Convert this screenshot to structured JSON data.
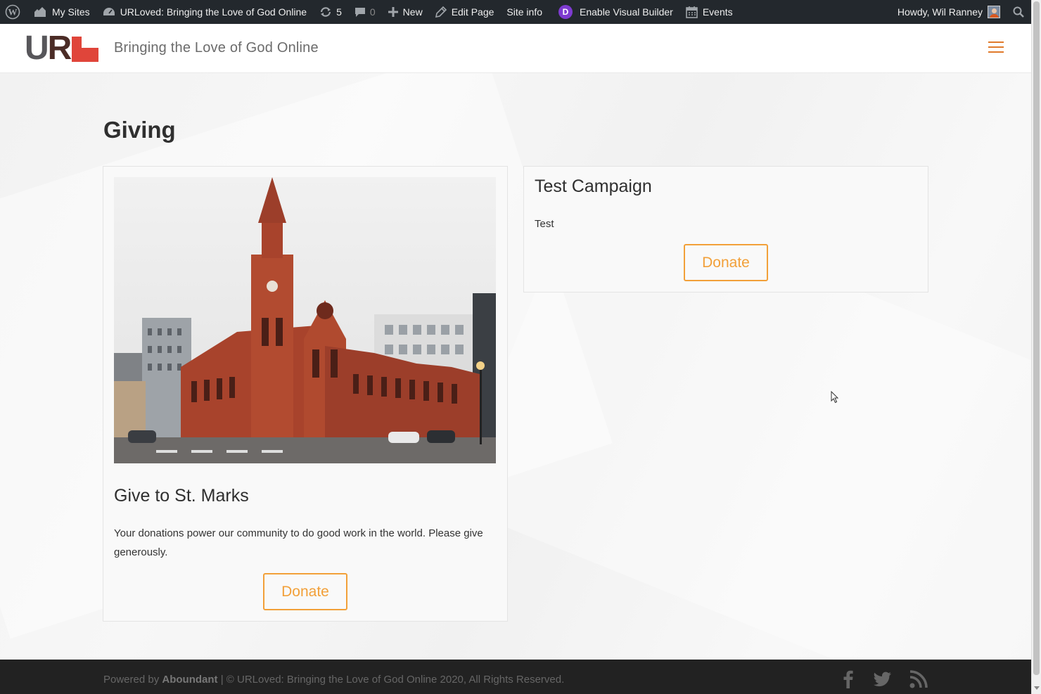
{
  "adminbar": {
    "my_sites": "My Sites",
    "site_name": "URLoved: Bringing the Love of God Online",
    "updates_count": "5",
    "comments_count": "0",
    "new_label": "New",
    "edit_page": "Edit Page",
    "site_info": "Site info",
    "divi_letter": "D",
    "visual_builder": "Enable Visual Builder",
    "events": "Events",
    "howdy": "Howdy, Wil Ranney"
  },
  "header": {
    "logo_u": "U",
    "logo_r": "R",
    "tagline": "Bringing the Love of God Online"
  },
  "main": {
    "title": "Giving",
    "campaigns": [
      {
        "title": "Give to St. Marks",
        "description": "Your donations power our community to do good work in the world. Please give generously.",
        "button": "Donate"
      },
      {
        "title": "Test Campaign",
        "description": "Test",
        "button": "Donate"
      }
    ]
  },
  "footer": {
    "powered_prefix": "Powered by",
    "powered_brand": "Aboundant",
    "copyright": "| © URLoved: Bringing the Love of God Online 2020, All Rights Reserved."
  },
  "colors": {
    "accent": "#f2a039",
    "adminbar": "#23282d",
    "logo_red": "#e0453a"
  },
  "icons": [
    "wordpress-icon",
    "my-sites-icon",
    "dashboard-icon",
    "updates-icon",
    "comments-icon",
    "plus-icon",
    "pencil-icon",
    "divi-icon",
    "calendar-icon",
    "search-icon",
    "hamburger-menu-icon",
    "facebook-icon",
    "twitter-icon",
    "rss-icon"
  ]
}
